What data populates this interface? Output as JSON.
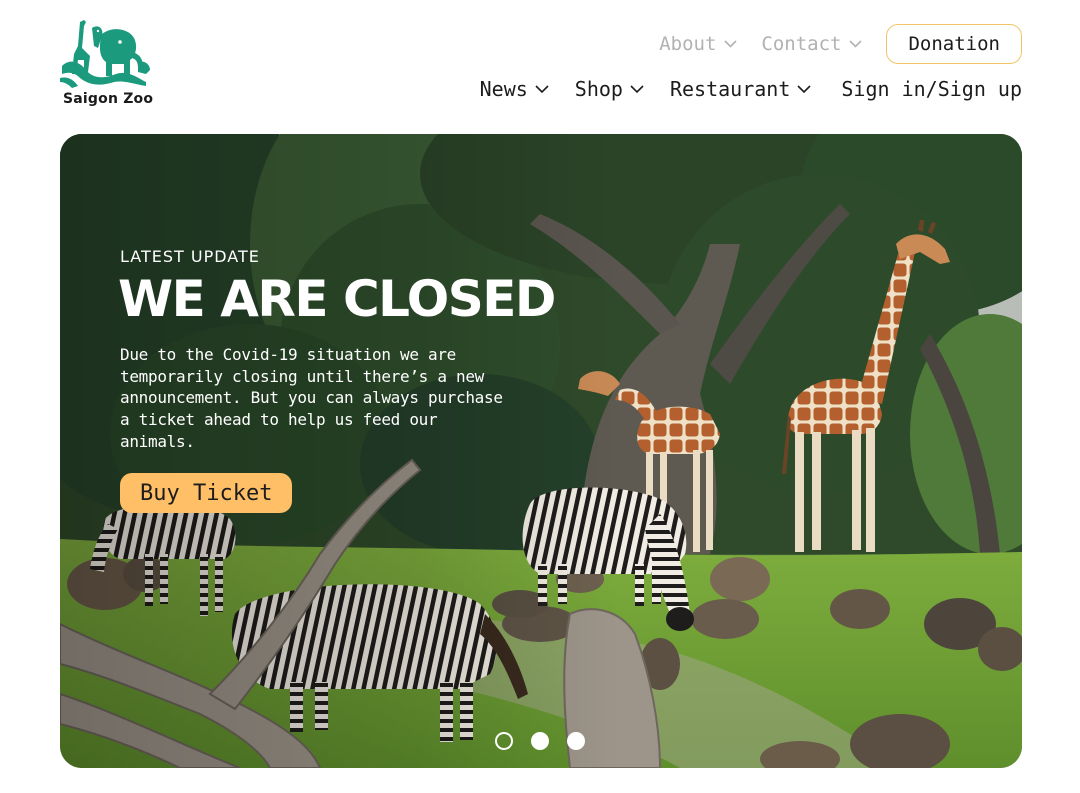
{
  "brand": {
    "name": "Saigon Zoo",
    "logo_color": "#1b9a7e"
  },
  "top_nav": {
    "items": [
      {
        "label": "About",
        "icon": "chevron-down-icon"
      },
      {
        "label": "Contact",
        "icon": "chevron-down-icon"
      }
    ],
    "donate_label": "Donation"
  },
  "main_nav": {
    "items": [
      {
        "label": "News",
        "icon": "chevron-down-icon"
      },
      {
        "label": "Shop",
        "icon": "chevron-down-icon"
      },
      {
        "label": "Restaurant",
        "icon": "chevron-down-icon"
      }
    ],
    "signin_label": "Sign in/Sign up"
  },
  "hero": {
    "eyebrow": "LATEST UPDATE",
    "title": "WE ARE CLOSED",
    "body": "Due to the Covid-19 situation we are temporarily closing until there’s a new announcement. But you can always purchase a ticket ahead to help us feed our animals.",
    "cta_label": "Buy Ticket",
    "image": "giraffes-and-zebras-photo",
    "slides": [
      {
        "state": "inactive"
      },
      {
        "state": "active"
      },
      {
        "state": "active"
      }
    ]
  },
  "colors": {
    "accent": "#ffbf66",
    "donate_border": "#f2c46a",
    "muted_nav": "#b2b2b2",
    "text": "#1c1c1c"
  }
}
